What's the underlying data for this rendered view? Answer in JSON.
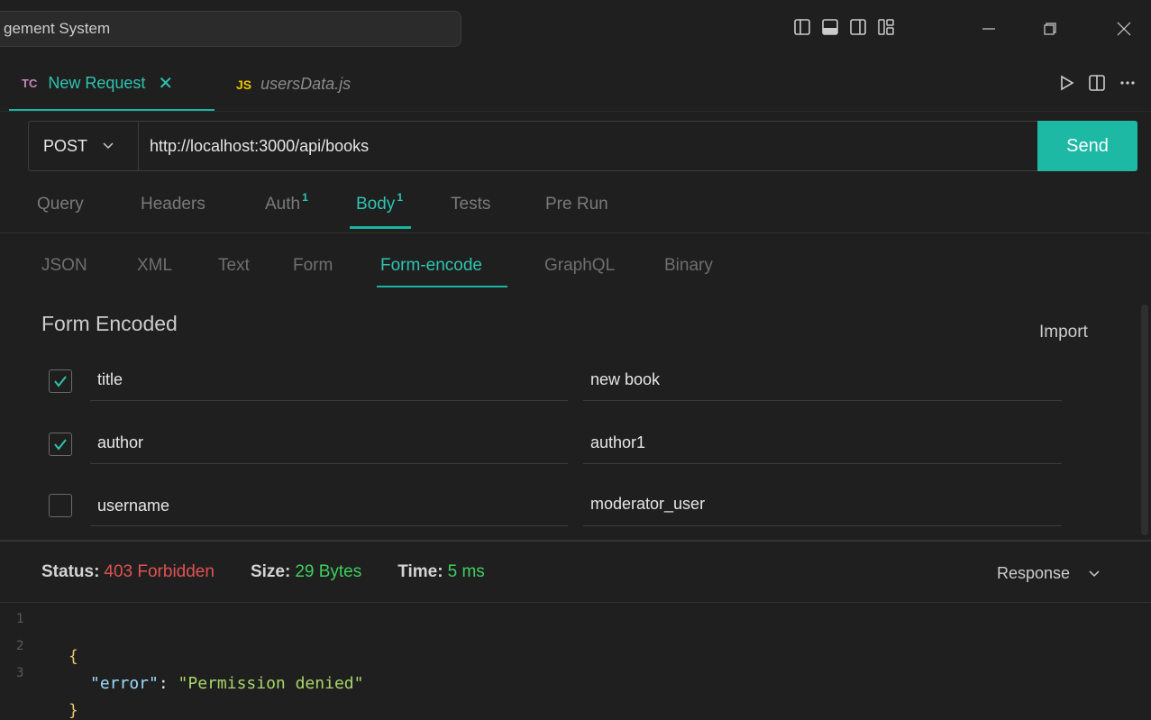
{
  "window": {
    "title_search": "gement System"
  },
  "tabs": [
    {
      "badge": "TC",
      "label": "New Request",
      "close": "✕"
    },
    {
      "badge": "JS",
      "label": "usersData.js"
    }
  ],
  "request": {
    "method": "POST",
    "url": "http://localhost:3000/api/books",
    "send_label": "Send"
  },
  "request_tabs": [
    {
      "label": "Query"
    },
    {
      "label": "Headers"
    },
    {
      "label": "Auth",
      "count": "1"
    },
    {
      "label": "Body",
      "count": "1"
    },
    {
      "label": "Tests"
    },
    {
      "label": "Pre Run"
    }
  ],
  "body_tabs": [
    "JSON",
    "XML",
    "Text",
    "Form",
    "Form-encode",
    "GraphQL",
    "Binary"
  ],
  "form": {
    "title": "Form Encoded",
    "import_label": "Import",
    "rows": [
      {
        "checked": true,
        "key": "title",
        "value": "new book"
      },
      {
        "checked": true,
        "key": "author",
        "value": "author1"
      },
      {
        "checked": false,
        "key": "username",
        "value": "moderator_user"
      }
    ]
  },
  "response": {
    "status_label": "Status:",
    "status_value": "403 Forbidden",
    "size_label": "Size:",
    "size_value": "29 Bytes",
    "time_label": "Time:",
    "time_value": "5 ms",
    "view_label": "Response",
    "lines": [
      {
        "n": "1",
        "open": "{"
      },
      {
        "n": "2",
        "key": "\"error\"",
        "sep": ": ",
        "val": "\"Permission denied\""
      },
      {
        "n": "3",
        "close": "}"
      }
    ]
  },
  "colors": {
    "accent": "#1db9a4",
    "error": "#e05252",
    "success": "#3fcf5e"
  }
}
